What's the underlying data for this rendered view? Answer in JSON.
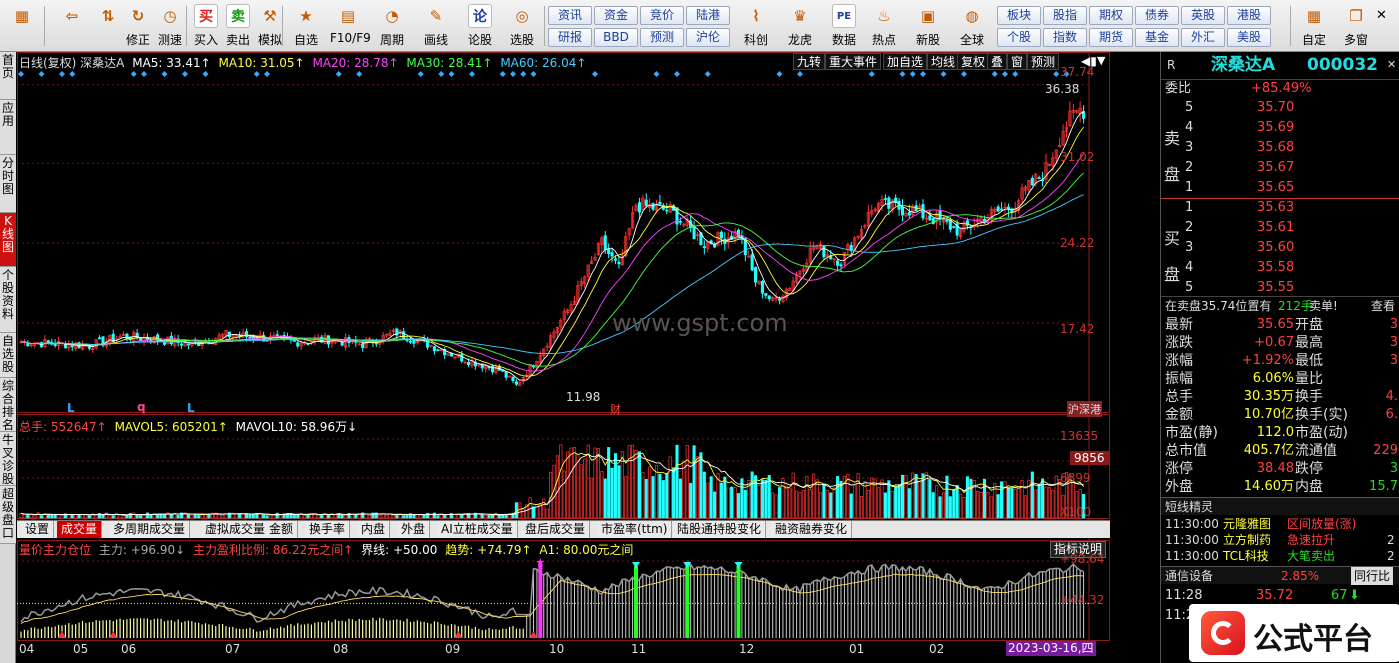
{
  "toolbar": {
    "items": [
      {
        "label": "",
        "icon": "grid-icon"
      },
      {
        "label": "",
        "icon": "back-arrow-icon"
      },
      {
        "label": "",
        "icon": "up-down-arrows-icon"
      },
      {
        "label": "修正",
        "icon": "refresh-icon"
      },
      {
        "label": "测速",
        "icon": "clock-icon"
      },
      {
        "label": "买入",
        "icon": "buy-icon",
        "glyph": "买"
      },
      {
        "label": "卖出",
        "icon": "sell-icon",
        "glyph": "卖"
      },
      {
        "label": "模拟",
        "icon": "gavel-icon"
      },
      {
        "label": "自选",
        "icon": "star-icon"
      },
      {
        "label": "F10/F9",
        "icon": "document-icon"
      },
      {
        "label": "周期",
        "icon": "cycle-icon"
      },
      {
        "label": "画线",
        "icon": "pencil-icon"
      },
      {
        "label": "论股",
        "icon": "discuss-icon",
        "glyph": "论"
      },
      {
        "label": "选股",
        "icon": "chart-select-icon"
      }
    ],
    "quick_top": [
      "资讯",
      "资金",
      "竞价",
      "陆港"
    ],
    "quick_bottom": [
      "研报",
      "BBD",
      "预测",
      "沪伦"
    ],
    "items2": [
      {
        "label": "科创",
        "icon": "kechuang-icon"
      },
      {
        "label": "龙虎",
        "icon": "dragon-tiger-icon"
      },
      {
        "label": "数据",
        "icon": "pe-icon",
        "glyph": "PE"
      },
      {
        "label": "热点",
        "icon": "hot-icon"
      },
      {
        "label": "新股",
        "icon": "new-stock-icon"
      },
      {
        "label": "全球",
        "icon": "globe-icon"
      }
    ],
    "quick2_top": [
      "板块",
      "股指",
      "期权",
      "债券",
      "英股",
      "港股"
    ],
    "quick2_bottom": [
      "个股",
      "指数",
      "期货",
      "基金",
      "外汇",
      "美股"
    ],
    "items3": [
      {
        "label": "自定",
        "icon": "customize-icon"
      },
      {
        "label": "多窗",
        "icon": "multi-window-icon"
      }
    ]
  },
  "left_tabs": [
    "首页",
    "应用",
    "分时图",
    "K线图",
    "个股资料",
    "自选股",
    "综合排名",
    "牛叉诊股",
    "超级盘口"
  ],
  "chart": {
    "header": {
      "name": "日线(复权)  深桑达A",
      "ma5": "MA5: 33.41↑",
      "ma10": "MA10: 31.05↑",
      "ma20": "MA20: 28.78↑",
      "ma30": "MA30: 28.41↑",
      "ma60": "MA60: 26.04↑"
    },
    "buttons": [
      "九转",
      "重大事件",
      "加自选",
      "均线",
      "复权",
      "叠",
      "窗",
      "预测"
    ],
    "price_labels": [
      "37.74",
      "31.02",
      "24.22",
      "17.42"
    ],
    "high_label": "36.38",
    "low_label": "11.98",
    "watermark": "www.gspt.com",
    "markers": [
      {
        "text": "L"
      },
      {
        "text": "q"
      },
      {
        "text": "L"
      },
      {
        "text": "财"
      },
      {
        "text": "沪深港"
      }
    ],
    "vol_header": {
      "total": "总手: 552647↑",
      "mavol5": "MAVOL5: 605201↑",
      "mavol10": "MAVOL10: 58.96万↓"
    },
    "vol_labels": [
      "13635",
      "9856",
      "6899",
      "X100"
    ],
    "tabs": [
      "设置",
      "成交量",
      "多周期成交量",
      "虚拟成交量",
      "金额",
      "换手率",
      "内盘",
      "外盘",
      "AI立桩成交量",
      "盘后成交量",
      "市盈率(ttm)",
      "陆股通持股变化",
      "融资融券变化"
    ],
    "active_tab": "成交量",
    "ind_header": {
      "name": "量价主力仓位",
      "main": "主力: +96.90↓",
      "cost": "主力盈利比例: 86.22元之间↑",
      "line": "界线: +50.00",
      "trend": "趋势: +74.79↑",
      "a1": "A1: 80.00元之间"
    },
    "ind_button": "指标说明",
    "ind_labels": [
      "+98.64",
      "+44.32"
    ],
    "x_labels": [
      "04",
      "05",
      "06",
      "07",
      "08",
      "09",
      "10",
      "11",
      "12",
      "01",
      "02"
    ],
    "date_label": "2023-03-16,四"
  },
  "chart_data": {
    "type": "candlestick",
    "title": "深桑达A 000032 日线(复权)",
    "ylim": [
      10.5,
      39.5
    ],
    "x_range": [
      "2022-04",
      "2023-03-16"
    ],
    "months": [
      "04",
      "05",
      "06",
      "07",
      "08",
      "09",
      "10",
      "11",
      "12",
      "01",
      "02"
    ],
    "close_keypoints": [
      [
        0,
        15.8
      ],
      [
        20,
        15.5
      ],
      [
        30,
        16.3
      ],
      [
        40,
        16.0
      ],
      [
        50,
        15.6
      ],
      [
        60,
        16.4
      ],
      [
        70,
        16.2
      ],
      [
        80,
        15.8
      ],
      [
        90,
        16.0
      ],
      [
        100,
        15.6
      ],
      [
        110,
        16.6
      ],
      [
        120,
        15.5
      ],
      [
        130,
        14.3
      ],
      [
        140,
        13.4
      ],
      [
        145,
        12.1
      ],
      [
        150,
        14.0
      ],
      [
        160,
        18.5
      ],
      [
        170,
        24.2
      ],
      [
        175,
        22.0
      ],
      [
        180,
        27.5
      ],
      [
        190,
        27.0
      ],
      [
        200,
        24.2
      ],
      [
        210,
        25.1
      ],
      [
        215,
        21.0
      ],
      [
        220,
        19.2
      ],
      [
        225,
        20.6
      ],
      [
        232,
        24.0
      ],
      [
        240,
        22.7
      ],
      [
        250,
        27.5
      ],
      [
        260,
        27.1
      ],
      [
        270,
        26.0
      ],
      [
        275,
        25.2
      ],
      [
        280,
        26.2
      ],
      [
        290,
        27.4
      ],
      [
        300,
        30.5
      ],
      [
        305,
        34.0
      ],
      [
        310,
        35.65
      ]
    ],
    "last_close": 35.65,
    "period_high": 36.38,
    "period_low": 11.98,
    "ma": {
      "ma5": 33.41,
      "ma10": 31.05,
      "ma20": 28.78,
      "ma30": 28.41,
      "ma60": 26.04
    },
    "volume": {
      "total": 552647,
      "mavol5": 605201,
      "mavol10": "58.96万",
      "ylim": [
        0,
        14500
      ],
      "ticks": [
        13635,
        9856,
        6899
      ]
    }
  },
  "quote": {
    "symbol": "R",
    "name": "深桑达A",
    "code": "000032",
    "weibi_label": "委比",
    "weibi": "+85.49%",
    "sell_label": "卖盘",
    "buy_label": "买盘",
    "sell": [
      {
        "lvl": "5",
        "price": "35.70"
      },
      {
        "lvl": "4",
        "price": "35.69"
      },
      {
        "lvl": "3",
        "price": "35.68"
      },
      {
        "lvl": "2",
        "price": "35.67"
      },
      {
        "lvl": "1",
        "price": "35.65"
      }
    ],
    "buy": [
      {
        "lvl": "1",
        "price": "35.63"
      },
      {
        "lvl": "2",
        "price": "35.61"
      },
      {
        "lvl": "3",
        "price": "35.60"
      },
      {
        "lvl": "4",
        "price": "35.58"
      },
      {
        "lvl": "5",
        "price": "35.55"
      }
    ],
    "sell_pos": "在卖盘35.74位置有",
    "sell_pos_vol": "212手",
    "sell_single": "卖单!",
    "view": "查看",
    "stats": [
      {
        "k1": "最新",
        "v1": "35.65",
        "k2": "开盘",
        "v2": "3"
      },
      {
        "k1": "涨跌",
        "v1": "+0.67",
        "k2": "最高",
        "v2": "3"
      },
      {
        "k1": "涨幅",
        "v1": "+1.92%",
        "k2": "最低",
        "v2": "3"
      },
      {
        "k1": "振幅",
        "v1": "6.06%",
        "k2": "量比",
        "v2": ""
      },
      {
        "k1": "总手",
        "v1": "30.35万",
        "k2": "换手",
        "v2": "4."
      },
      {
        "k1": "金额",
        "v1": "10.70亿",
        "k2": "换手(实)",
        "v2": "6."
      },
      {
        "k1": "市盈(静)",
        "v1": "112.0",
        "k2": "市盈(动)",
        "v2": ""
      },
      {
        "k1": "总市值",
        "v1": "405.7亿",
        "k2": "流通值",
        "v2": "229"
      },
      {
        "k1": "涨停",
        "v1": "38.48",
        "k2": "跌停",
        "v2": "3"
      },
      {
        "k1": "外盘",
        "v1": "14.60万",
        "k2": "内盘",
        "v2": "15.7"
      }
    ],
    "elf_title": "短线精灵",
    "elf": [
      {
        "t": "11:30:00",
        "n": "元隆雅图",
        "e": "区间放量(涨)",
        "v": ""
      },
      {
        "t": "11:30:00",
        "n": "立方制药",
        "e": "急速拉升",
        "v": "2"
      },
      {
        "t": "11:30:00",
        "n": "TCL科技",
        "e": "大笔卖出",
        "v": "2"
      }
    ],
    "comm_label": "通信设备",
    "comm_pct": "2.85%",
    "peer_rank": "同行比",
    "ticks": [
      {
        "t": "11:28",
        "p": "35.72",
        "v": "67"
      },
      {
        "t": "11:29",
        "p": "",
        "v": ""
      }
    ],
    "logo": "公式平台"
  }
}
